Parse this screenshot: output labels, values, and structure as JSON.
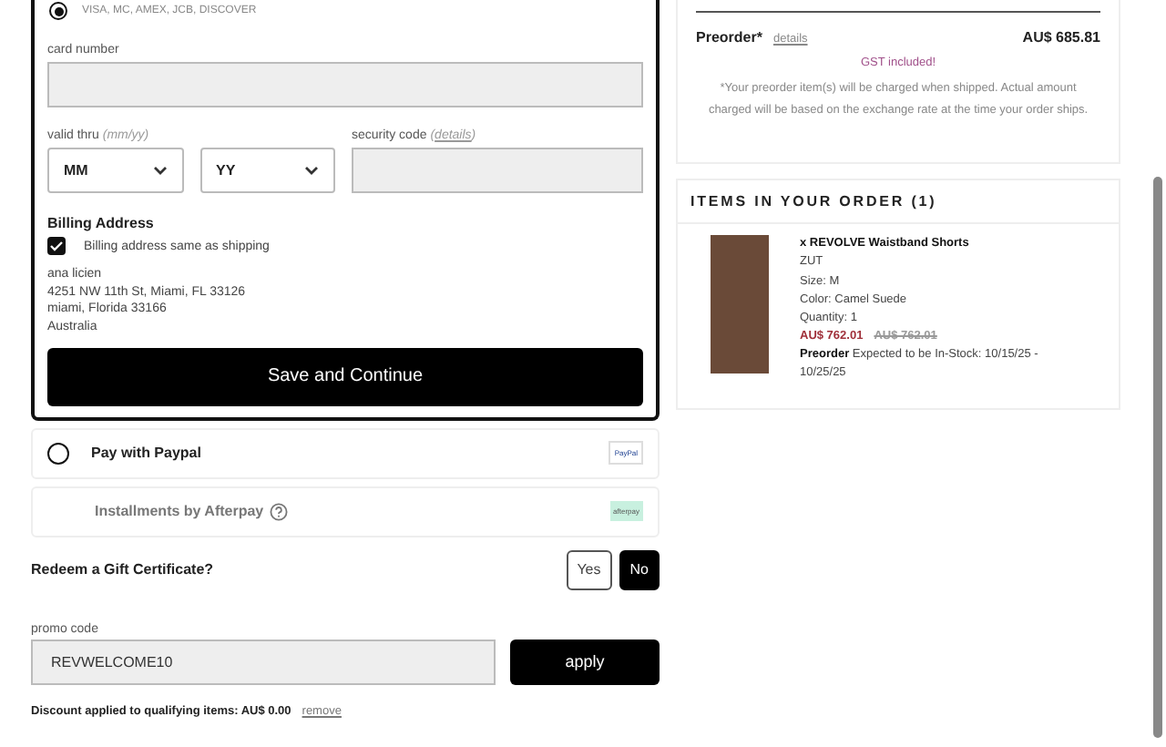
{
  "card_payment": {
    "selected": true,
    "brands": "VISA, MC, AMEX, JCB, DISCOVER",
    "card_number_label": "card number",
    "valid_thru_label": "valid thru",
    "valid_thru_hint": "(mm/yy)",
    "month_select": "MM",
    "year_select": "YY",
    "security_label": "security code",
    "security_open": "(",
    "security_link": "details",
    "security_close": ")",
    "billing_title": "Billing Address",
    "same_as_shipping": {
      "label": "Billing address same as shipping",
      "checked": true
    },
    "address": [
      "ana licien",
      "4251 NW 11th St, Miami, FL 33126",
      "miami, Florida 33166",
      "Australia"
    ],
    "save_button": "Save and Continue"
  },
  "other_methods": [
    {
      "kind": "paypal",
      "label": "Pay with Paypal",
      "selected": false,
      "logo": "PayPal"
    },
    {
      "kind": "afterpay",
      "label": "Installments by Afterpay",
      "selected": false,
      "logo": "afterpay"
    }
  ],
  "gift": {
    "question": "Redeem a Gift Certificate?",
    "options": [
      {
        "label": "Yes",
        "selected": false
      },
      {
        "label": "No",
        "selected": true
      }
    ]
  },
  "promo": {
    "label": "promo code",
    "value": "REVWELCOME10",
    "apply": "apply",
    "discount": "Discount applied to qualifying items: AU$ 0.00",
    "remove": "remove"
  },
  "summary": {
    "preorder_label": "Preorder*",
    "details_link": "details",
    "preorder_amount": "AU$ 685.81",
    "gst": "GST included!",
    "note": "*Your preorder item(s) will be charged when shipped. Actual amount charged will be based on the exchange rate at the time your order ships."
  },
  "order": {
    "title": "ITEMS IN YOUR ORDER (1)",
    "items": [
      {
        "name": "x REVOLVE Waistband Shorts",
        "brand": "ZUT",
        "size": "Size:  M",
        "color_label": "Color:  Camel Suede",
        "quantity": "Quantity:  1",
        "price": "AU$ 762.01",
        "old_price": "AU$ 762.01",
        "preorder": "Preorder",
        "expected": "Expected to be In-Stock: 10/15/25 - 10/25/25"
      }
    ]
  }
}
